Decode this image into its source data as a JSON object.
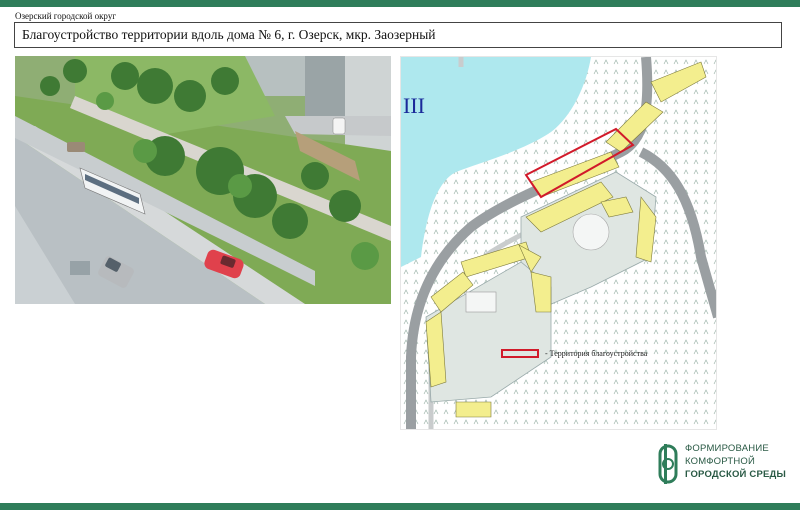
{
  "header": {
    "organization": "Озерский городской округ",
    "title": "Благоустройство территории вдоль дома № 6, г. Озерск, мкр. Заозерный"
  },
  "map": {
    "corner_label": "III",
    "legend_text": "- Территория благоустройства",
    "legend_color": "#d11a2a"
  },
  "logo": {
    "line1": "ФОРМИРОВАНИЕ",
    "line2": "КОМФОРТНОЙ",
    "line3": "ГОРОДСКОЙ СРЕДЫ"
  },
  "colors": {
    "brand_green": "#2f7d5a",
    "building_yellow": "#f3ee8e",
    "water_blue": "#aee8ee"
  }
}
